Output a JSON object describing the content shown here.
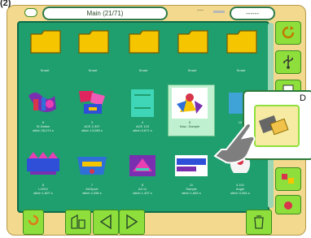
{
  "figure_label": "(2)",
  "header": {
    "title": "Main (21/71)",
    "center_label": "----",
    "right_label": "------"
  },
  "folders": [
    {
      "caption": "Smart"
    },
    {
      "caption": "Smart"
    },
    {
      "caption": "Smart"
    },
    {
      "caption": "Smart"
    },
    {
      "caption": "Smart"
    }
  ],
  "designs_row1": [
    {
      "line1": "8",
      "line2": "St Dalton",
      "line3": "stitch 35,074 s"
    },
    {
      "line1": "3",
      "line2": "ACE 2,397",
      "line3": "stitch 13,089 s"
    },
    {
      "line1": "4",
      "line2": "ACE 123",
      "line3": "stitch 5,871 s"
    },
    {
      "line1": "5",
      "line2": "Kaw...Sample",
      "line3": ""
    },
    {
      "line1": "10",
      "line2": "",
      "line3": ""
    }
  ],
  "designs_row2": [
    {
      "line1": "8",
      "line2": "LOGO",
      "line3": "stitch 1,807 s"
    },
    {
      "line1": "7",
      "line2": "McSport",
      "line3": "stitch 2,056 s"
    },
    {
      "line1": "8",
      "line2": "A3 11",
      "line3": "stitch 1,437 s"
    },
    {
      "line1": "11",
      "line2": "Sample",
      "line3": "stitch 1,683 s"
    },
    {
      "line1": "4 101",
      "line2": "Angel",
      "line3": "stitch 3,364 s"
    }
  ],
  "callout": {
    "label": "D"
  },
  "colors": {
    "frame": "#f2d98e",
    "screen": "#1f9e6e",
    "button": "#8fdf3c",
    "folder": "#f5c500"
  }
}
